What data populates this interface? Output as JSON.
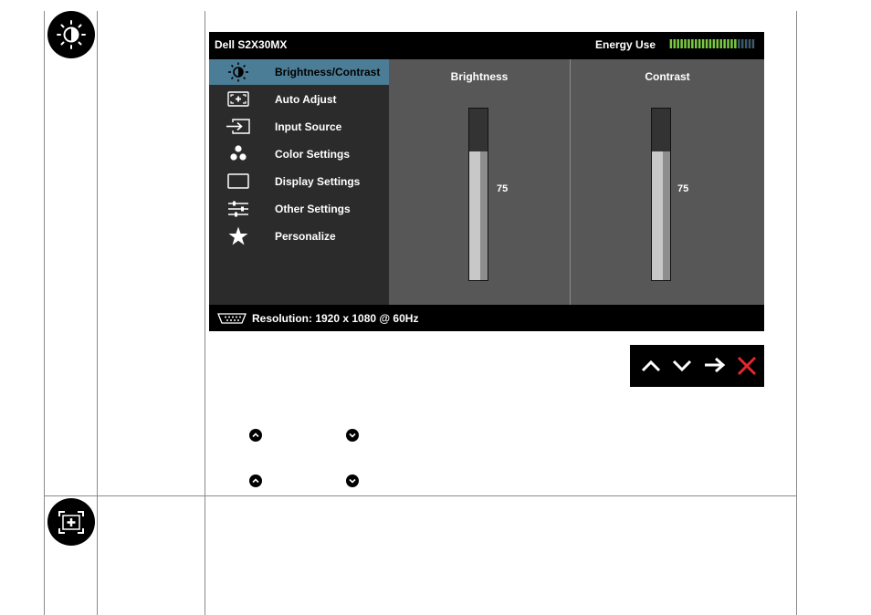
{
  "osd": {
    "title": "Dell S2X30MX",
    "energy_label": "Energy Use",
    "energy_level": 0.78,
    "menu": [
      {
        "label": "Brightness/Contrast",
        "icon": "brightness-contrast-icon",
        "active": true
      },
      {
        "label": "Auto Adjust",
        "icon": "auto-adjust-icon",
        "active": false
      },
      {
        "label": "Input Source",
        "icon": "input-source-icon",
        "active": false
      },
      {
        "label": "Color Settings",
        "icon": "color-settings-icon",
        "active": false
      },
      {
        "label": "Display Settings",
        "icon": "display-settings-icon",
        "active": false
      },
      {
        "label": "Other Settings",
        "icon": "other-settings-icon",
        "active": false
      },
      {
        "label": "Personalize",
        "icon": "star-icon",
        "active": false
      }
    ],
    "brightness": {
      "title": "Brightness",
      "value": "75",
      "level": 0.75
    },
    "contrast": {
      "title": "Contrast",
      "value": "75",
      "level": 0.75
    },
    "status": {
      "resolution": "Resolution: 1920 x 1080 @ 60Hz",
      "icon": "vga-connector-icon"
    }
  },
  "nav_buttons": [
    "up-arrow-icon",
    "down-arrow-icon",
    "right-arrow-icon",
    "close-icon"
  ],
  "colors": {
    "highlight": "#4c7d97",
    "panel": "#575757",
    "menu_bg": "#2b2b2b",
    "energy_green": "#7ac943",
    "close_red": "#e8262c"
  }
}
